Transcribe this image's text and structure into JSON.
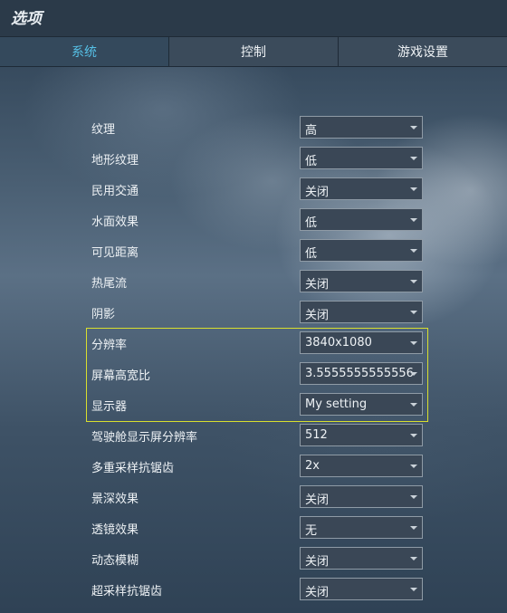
{
  "window": {
    "title": "选项"
  },
  "tabs": [
    {
      "label": "系统",
      "active": true
    },
    {
      "label": "控制",
      "active": false
    },
    {
      "label": "游戏设置",
      "active": false
    }
  ],
  "accent_color": "#56c0e6",
  "highlight_color": "#d9df2e",
  "settings": [
    {
      "label": "纹理",
      "value": "高"
    },
    {
      "label": "地形纹理",
      "value": "低"
    },
    {
      "label": "民用交通",
      "value": "关闭"
    },
    {
      "label": "水面效果",
      "value": "低"
    },
    {
      "label": "可见距离",
      "value": "低"
    },
    {
      "label": "热尾流",
      "value": "关闭"
    },
    {
      "label": "阴影",
      "value": "关闭"
    },
    {
      "label": "分辨率",
      "value": "3840x1080"
    },
    {
      "label": "屏幕高宽比",
      "value": "3.5555555555556"
    },
    {
      "label": "显示器",
      "value": "My setting"
    },
    {
      "label": "驾驶舱显示屏分辨率",
      "value": "512"
    },
    {
      "label": "多重采样抗锯齿",
      "value": "2x"
    },
    {
      "label": "景深效果",
      "value": "关闭"
    },
    {
      "label": "透镜效果",
      "value": "无"
    },
    {
      "label": "动态模糊",
      "value": "关闭"
    },
    {
      "label": "超采样抗锯齿",
      "value": "关闭"
    }
  ],
  "highlighted_group": [
    "分辨率",
    "屏幕高宽比",
    "显示器"
  ]
}
